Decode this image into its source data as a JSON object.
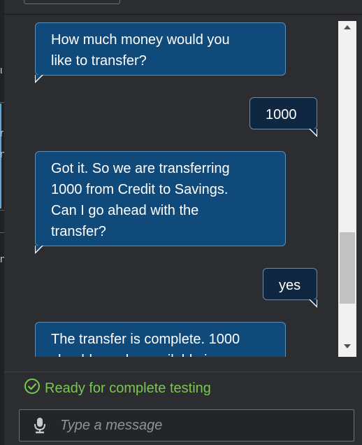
{
  "edge_glyphs": [
    "ι",
    "r",
    "n",
    "n"
  ],
  "messages": [
    {
      "from": "bot",
      "text_lines": [
        "How much money would you",
        "like to transfer?"
      ]
    },
    {
      "from": "user",
      "text_lines": [
        "1000"
      ]
    },
    {
      "from": "bot",
      "text_lines": [
        "Got it. So we are transferring",
        "1000 from Credit to Savings.",
        "Can I go ahead with the",
        "transfer?"
      ]
    },
    {
      "from": "user",
      "text_lines": [
        "yes"
      ]
    },
    {
      "from": "bot",
      "text_lines": [
        "The transfer is complete. 1000",
        "should now be available in"
      ]
    }
  ],
  "status": {
    "text": "Ready for complete testing",
    "icon": "check-circle-icon",
    "color": "#7ac74f"
  },
  "input": {
    "placeholder": "Type a message",
    "value": "",
    "icon": "microphone-icon"
  },
  "scrollbar": {
    "icons": [
      "scroll-up-arrow-icon",
      "scroll-down-arrow-icon"
    ]
  }
}
